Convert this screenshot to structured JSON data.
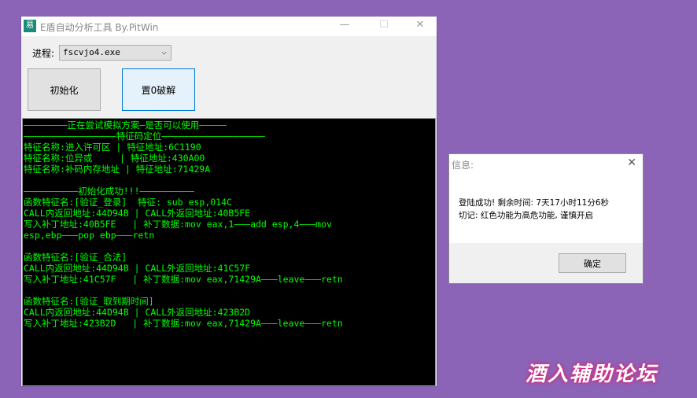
{
  "window": {
    "title": "E盾自动分析工具   By.PitWin",
    "icon": "app-icon",
    "minimize": "—",
    "maximize": "☐",
    "close": "✕"
  },
  "process": {
    "label": "进程:",
    "value": "fscvjo4.exe"
  },
  "buttons": {
    "init": "初始化",
    "crack": "置0破解"
  },
  "console": {
    "lines": [
      "————————正在尝试模拟方案—是否可以使用—————",
      "—————————————————特征码定位———————————————————",
      "特征名称:进入许可区 | 特征地址:6C1190",
      "特征名称:位异或     | 特征地址:430A00",
      "特征名称:补码内存地址 | 特征地址:71429A",
      "",
      "——————————初始化成功!!!——————————",
      "函数特征名:[验证_登录]  特征: sub esp,014C",
      "CALL内返回地址:44D94B | CALL外返回地址:40B5FE",
      "写入补丁地址:40B5FE   | 补丁数据:mov eax,1———add esp,4———mov",
      "esp,ebp———pop ebp———retn",
      "",
      "函数特征名:[验证_合法]",
      "CALL内返回地址:44D94B | CALL外返回地址:41C57F",
      "写入补丁地址:41C57F   | 补丁数据:mov eax,71429A———leave———retn",
      "",
      "函数特征名:[验证_取到期时间]",
      "CALL内返回地址:44D94B | CALL外返回地址:423B2D",
      "写入补丁地址:423B2D   | 补丁数据:mov eax,71429A———leave———retn"
    ]
  },
  "dialog": {
    "title": "信息:",
    "close": "✕",
    "line1": "登陆成功! 剩余时间:  7天17小时11分6秒",
    "line2": "切记:  红色功能为高危功能, 谨慎开启",
    "ok": "确定"
  },
  "watermark": "酒入辅助论坛",
  "colors": {
    "background": "#8b64b8",
    "console_text": "#00ff00",
    "console_bg": "#000000",
    "focus_border": "#0078d7"
  }
}
